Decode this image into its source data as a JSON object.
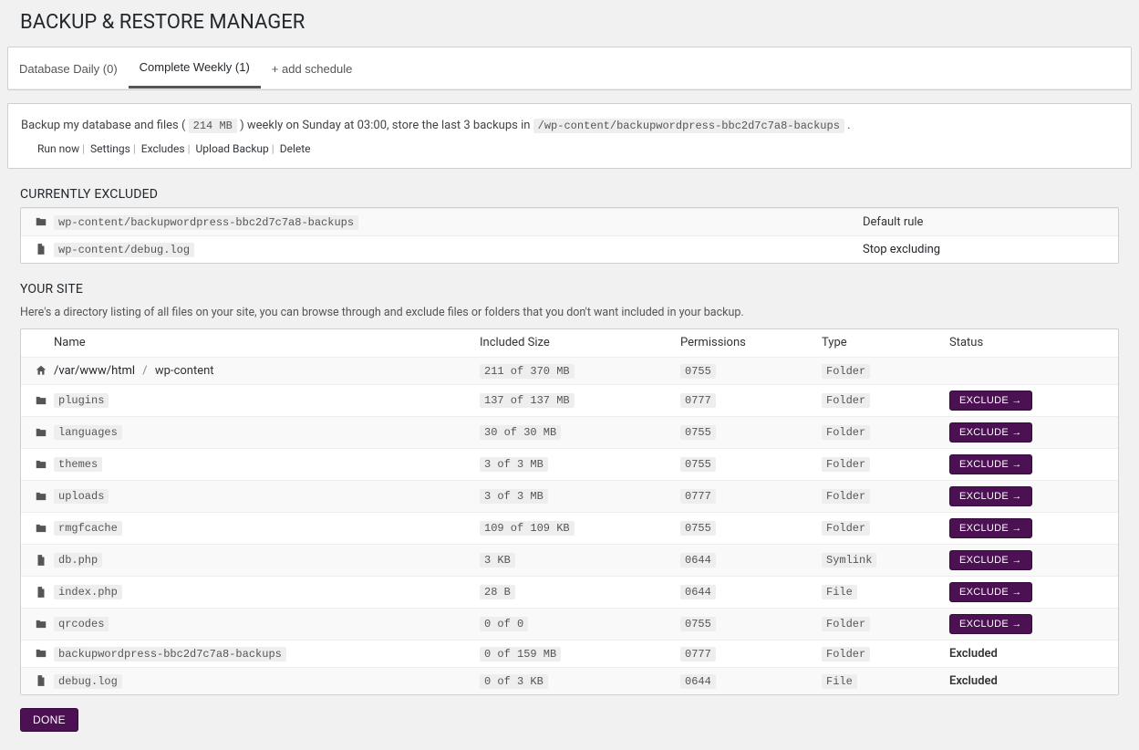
{
  "pageTitle": "BACKUP & RESTORE MANAGER",
  "tabs": {
    "db": "Database Daily (0)",
    "complete": "Complete Weekly (1)",
    "add": "+ add schedule"
  },
  "schedule": {
    "prefix": "Backup my database and files ( ",
    "size": "214 MB",
    "mid": " ) weekly on Sunday at 03:00, store the last 3 backups in ",
    "path": "/wp-content/backupwordpress-bbc2d7c7a8-backups",
    "suffix": " ."
  },
  "actions": {
    "runNow": "Run now",
    "settings": "Settings",
    "excludes": "Excludes",
    "upload": "Upload Backup",
    "delete": "Delete"
  },
  "excludedHeading": "CURRENTLY EXCLUDED",
  "excluded": [
    {
      "icon": "folder",
      "path": "wp-content/backupwordpress-bbc2d7c7a8-backups",
      "rule": "Default rule",
      "isLink": false
    },
    {
      "icon": "file",
      "path": "wp-content/debug.log",
      "rule": "Stop excluding",
      "isLink": true
    }
  ],
  "yourSiteHeading": "YOUR SITE",
  "yourSiteDesc": "Here's a directory listing of all files on your site, you can browse through and exclude files or folders that you don't want included in your backup.",
  "cols": {
    "name": "Name",
    "size": "Included Size",
    "perm": "Permissions",
    "type": "Type",
    "status": "Status"
  },
  "breadcrumb": {
    "root": "/var/www/html",
    "current": "wp-content",
    "size": "211 of 370 MB",
    "perm": "0755",
    "type": "Folder"
  },
  "rows": [
    {
      "icon": "folder",
      "name": "plugins",
      "size": "137 of 137 MB",
      "perm": "0777",
      "type": "Folder",
      "status": "exclude"
    },
    {
      "icon": "folder",
      "name": "languages",
      "size": "30 of 30 MB",
      "perm": "0755",
      "type": "Folder",
      "status": "exclude"
    },
    {
      "icon": "folder",
      "name": "themes",
      "size": "3 of 3 MB",
      "perm": "0755",
      "type": "Folder",
      "status": "exclude"
    },
    {
      "icon": "folder",
      "name": "uploads",
      "size": "3 of 3 MB",
      "perm": "0777",
      "type": "Folder",
      "status": "exclude"
    },
    {
      "icon": "folder",
      "name": "rmgfcache",
      "size": "109 of 109 KB",
      "perm": "0755",
      "type": "Folder",
      "status": "exclude"
    },
    {
      "icon": "file",
      "name": "db.php",
      "size": "3 KB",
      "perm": "0644",
      "type": "Symlink",
      "status": "exclude"
    },
    {
      "icon": "file",
      "name": "index.php",
      "size": "28 B",
      "perm": "0644",
      "type": "File",
      "status": "exclude"
    },
    {
      "icon": "folder",
      "name": "qrcodes",
      "size": "0 of 0",
      "perm": "0755",
      "type": "Folder",
      "status": "exclude"
    },
    {
      "icon": "folder",
      "name": "backupwordpress-bbc2d7c7a8-backups",
      "size": "0 of 159 MB",
      "perm": "0777",
      "type": "Folder",
      "status": "excluded"
    },
    {
      "icon": "file",
      "name": "debug.log",
      "size": "0 of 3 KB",
      "perm": "0644",
      "type": "File",
      "status": "excluded"
    }
  ],
  "excludeBtn": "EXCLUDE →",
  "excludedText": "Excluded",
  "doneBtn": "DONE"
}
